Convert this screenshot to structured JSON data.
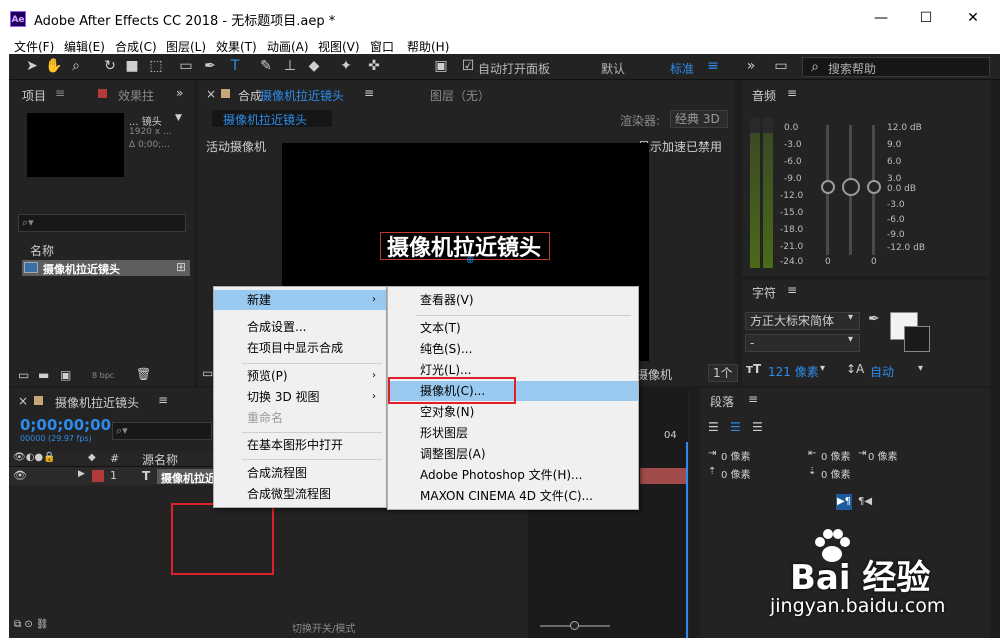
{
  "window": {
    "title": "Adobe After Effects CC 2018 - 无标题项目.aep *",
    "logo": "Ae",
    "minimize": "—",
    "maximize": "☐",
    "close": "✕"
  },
  "menubar": {
    "items": [
      "文件(F)",
      "编辑(E)",
      "合成(C)",
      "图层(L)",
      "效果(T)",
      "动画(A)",
      "视图(V)",
      "窗口",
      "帮助(H)"
    ]
  },
  "toolbar": {
    "auto_open_panels": "自动打开面板",
    "workspace_default": "默认",
    "workspace_standard": "标准",
    "help_search": "搜索帮助"
  },
  "project_panel": {
    "title": "项目",
    "effects_tab": "效果拄",
    "item_name": "... 镜头",
    "item_dims": "1920 x ...",
    "item_duration": "Δ 0;00;...",
    "column_name": "名称",
    "row_name": "摄像机拉近镜头",
    "bpc": "8 bpc"
  },
  "comp_panel": {
    "tab_prefix": "合成",
    "tab_name": "摄像机拉近镜头",
    "layer_tab": "图层（无）",
    "breadcrumb": "摄像机拉近镜头",
    "renderer_label": "渲染器:",
    "renderer_value": "经典 3D",
    "active_camera": "活动摄像机",
    "gpu_status": "显示加速已禁用",
    "comp_text": "摄像机拉近镜头",
    "view_label": "摄像机",
    "view_count": "1个"
  },
  "audio_panel": {
    "title": "音频",
    "left_scale": [
      "0.0",
      "-3.0",
      "-6.0",
      "-9.0",
      "-12.0",
      "-15.0",
      "-18.0",
      "-21.0",
      "-24.0"
    ],
    "right_scale": [
      "12.0 dB",
      "9.0",
      "6.0",
      "3.0",
      "0.0 dB",
      "-3.0",
      "-6.0",
      "-9.0",
      "-12.0 dB"
    ],
    "zero_left": "0",
    "zero_right": "0"
  },
  "character_panel": {
    "title": "字符",
    "font": "方正大标宋简体",
    "style": "-",
    "size": "121 像素",
    "leading": "自动"
  },
  "paragraph_panel": {
    "title": "段落",
    "indent_1": "0 像素",
    "indent_2": "0 像素",
    "indent_3": "0 像素",
    "space_1": "0 像素",
    "space_2": "0 像素"
  },
  "timeline": {
    "tab_name": "摄像机拉近镜头",
    "timecode": "0;00;00;00",
    "fps": "00000 (29.97 fps)",
    "col_source": "源名称",
    "col_num": "#",
    "layer_num": "1",
    "layer_type": "T",
    "layer_name": "摄像机拉近",
    "toggle_switches": "切换开关/模式",
    "ruler_mark": "04"
  },
  "context_menu": {
    "items": [
      "新建",
      "合成设置...",
      "在项目中显示合成",
      "预览(P)",
      "切换 3D 视图",
      "重命名",
      "在基本图形中打开",
      "合成流程图",
      "合成微型流程图"
    ]
  },
  "submenu": {
    "items": [
      "查看器(V)",
      "文本(T)",
      "纯色(S)...",
      "灯光(L)...",
      "摄像机(C)...",
      "空对象(N)",
      "形状图层",
      "调整图层(A)",
      "Adobe Photoshop 文件(H)...",
      "MAXON CINEMA 4D 文件(C)..."
    ]
  },
  "watermark": {
    "brand": "Bai 经验",
    "url": "jingyan.baidu.com"
  },
  "colors": {
    "accent_blue": "#2d8ceb",
    "highlight": "#99c9ef",
    "annotation_red": "#e0202a"
  }
}
